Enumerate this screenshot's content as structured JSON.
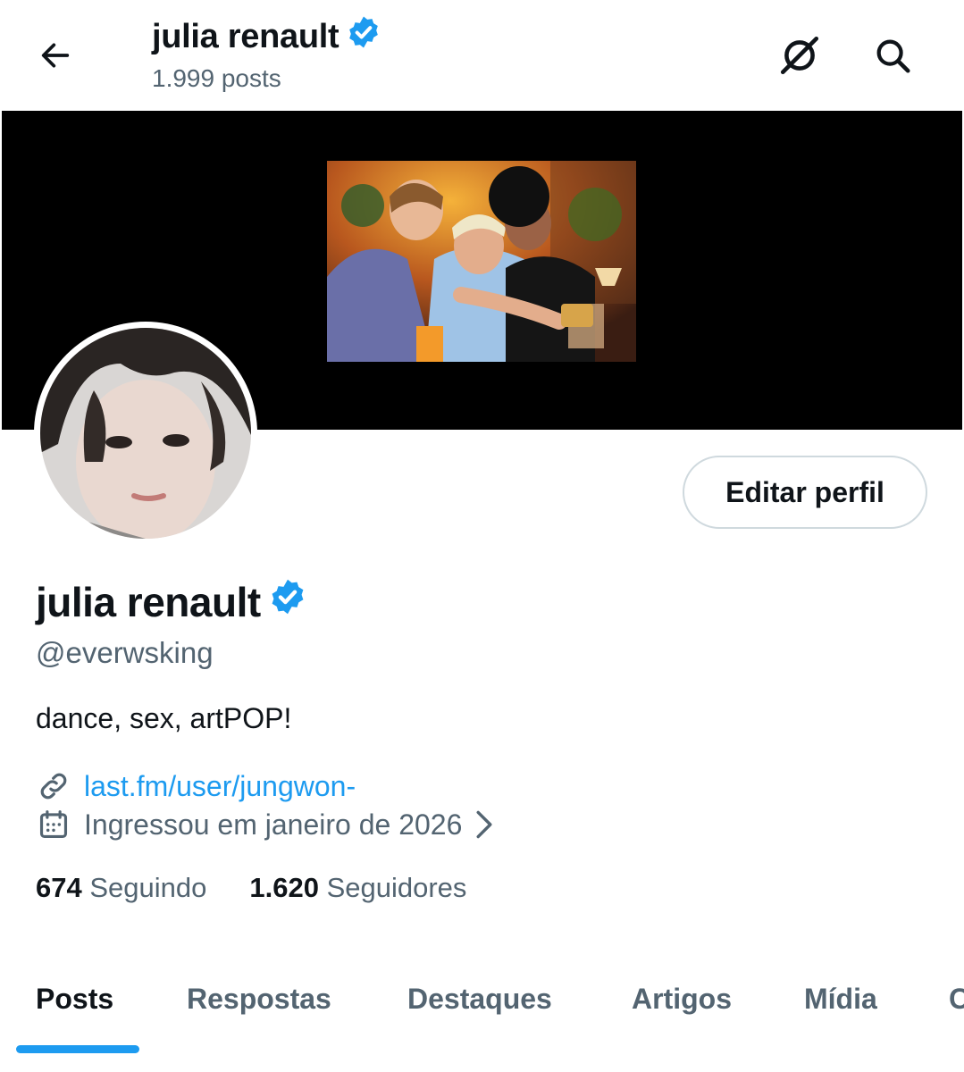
{
  "header": {
    "title": "julia renault",
    "post_count": "1.999 posts",
    "icons": [
      "back-arrow-icon",
      "grok-icon",
      "search-icon"
    ]
  },
  "profile": {
    "name": "julia renault",
    "handle": "@everwsking",
    "bio": "dance, sex, artPOP!",
    "link": "last.fm/user/jungwon-",
    "joined": "Ingressou em janeiro de 2026",
    "edit_label": "Editar perfil",
    "verified_color": "#1d9bf0"
  },
  "stats": {
    "following_count": "674",
    "following_label": "Seguindo",
    "followers_count": "1.620",
    "followers_label": "Seguidores"
  },
  "tabs": [
    {
      "label": "Posts",
      "active": true
    },
    {
      "label": "Respostas"
    },
    {
      "label": "Destaques"
    },
    {
      "label": "Artigos"
    },
    {
      "label": "Mídia"
    },
    {
      "label": "C"
    }
  ],
  "colors": {
    "accent": "#1d9bf0",
    "text": "#0f1419",
    "muted": "#536471",
    "banner": "#000000"
  }
}
